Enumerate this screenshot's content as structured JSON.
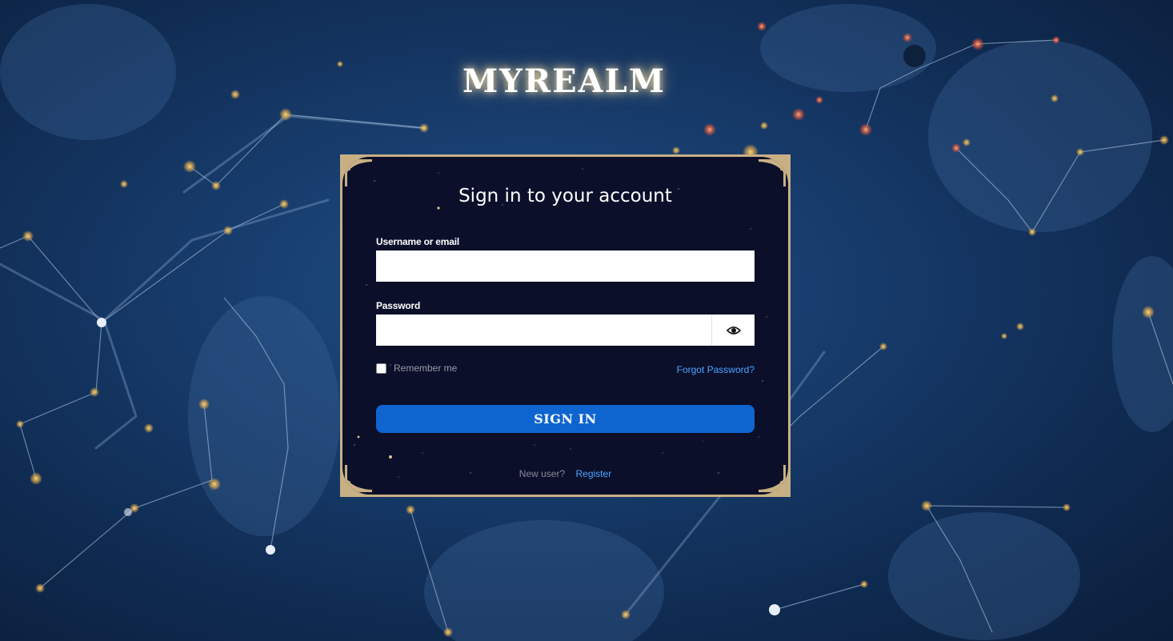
{
  "brand": {
    "logo_text": "MYREALM"
  },
  "login": {
    "title": "Sign in to your account",
    "username_label": "Username or email",
    "username_value": "",
    "password_label": "Password",
    "password_value": "",
    "show_password_icon": "eye-icon",
    "remember_label": "Remember me",
    "remember_checked": false,
    "forgot_link": "Forgot Password?",
    "submit_label": "SIGN IN",
    "new_user_text": "New user?",
    "register_link": "Register"
  },
  "colors": {
    "background": "#173c6c",
    "card_background": "#0b0f2a",
    "card_border": "#c8b084",
    "primary_button": "#0f65d0",
    "link": "#4aa6ff"
  }
}
